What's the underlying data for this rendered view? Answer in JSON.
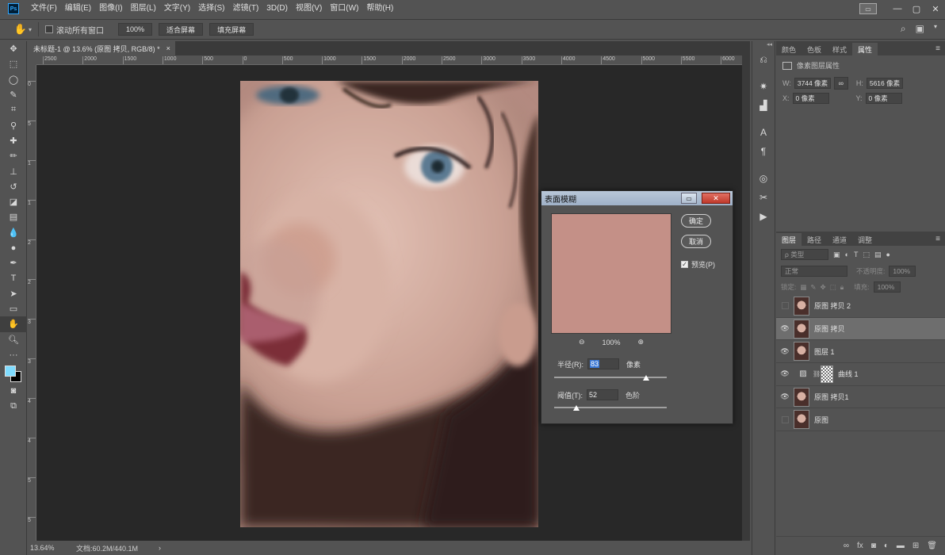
{
  "app": {
    "logo": "Ps",
    "menu": [
      "文件(F)",
      "编辑(E)",
      "图像(I)",
      "图层(L)",
      "文字(Y)",
      "选择(S)",
      "滤镜(T)",
      "3D(D)",
      "视图(V)",
      "窗口(W)",
      "帮助(H)"
    ]
  },
  "options": {
    "scroll_all_label": "滚动所有窗口",
    "zoom_value": "100%",
    "fit_screen": "适合屏幕",
    "fill_screen": "填充屏幕"
  },
  "document": {
    "tab_title": "未标题-1 @ 13.6% (原图 拷贝, RGB/8) *",
    "tab_close": "×",
    "ruler_h": [
      "2500",
      "2000",
      "1500",
      "1000",
      "500",
      "0",
      "500",
      "1000",
      "1500",
      "2000",
      "2500",
      "3000",
      "3500",
      "4000",
      "4500",
      "5000",
      "5500",
      "6000"
    ],
    "ruler_v": [
      "0",
      "5",
      "1",
      "1",
      "2",
      "2",
      "3",
      "3",
      "4",
      "4",
      "5",
      "5",
      "5"
    ],
    "zoom_status": "13.64%",
    "doc_status": "文档:60.2M/440.1M",
    "status_arrow": "›"
  },
  "properties": {
    "tabs": [
      "颜色",
      "色板",
      "样式",
      "属性"
    ],
    "active_tab": "属性",
    "title": "像素图层属性",
    "w_label": "W:",
    "w_value": "3744 像素",
    "h_label": "H:",
    "h_value": "5616 像素",
    "x_label": "X:",
    "x_value": "0 像素",
    "y_label": "Y:",
    "y_value": "0 像素",
    "link_icon": "∞"
  },
  "layers_panel": {
    "tabs": [
      "图层",
      "路径",
      "通道",
      "调整"
    ],
    "active_tab": "图层",
    "filter_placeholder": "ρ 类型",
    "blend_mode": "正常",
    "opacity_label": "不透明度:",
    "opacity_value": "100%",
    "lock_label": "锁定:",
    "fill_label": "填充:",
    "fill_value": "100%",
    "layers": [
      {
        "name": "原图 拷贝 2",
        "visible": false,
        "selected": false,
        "type": "pixel"
      },
      {
        "name": "原图 拷贝",
        "visible": true,
        "selected": true,
        "type": "pixel"
      },
      {
        "name": "图层 1",
        "visible": true,
        "selected": false,
        "type": "pixel"
      },
      {
        "name": "曲线 1",
        "visible": true,
        "selected": false,
        "type": "adjustment"
      },
      {
        "name": "原图 拷贝1",
        "visible": true,
        "selected": false,
        "type": "pixel"
      },
      {
        "name": "原图",
        "visible": false,
        "selected": false,
        "type": "pixel"
      }
    ]
  },
  "dialog": {
    "title": "表面模糊",
    "ok": "确定",
    "cancel": "取消",
    "preview_label": "预览(P)",
    "preview_checked": true,
    "zoom": "100%",
    "radius_label": "半径(R):",
    "radius_value": "83",
    "radius_unit": "像素",
    "radius_slider": 0.82,
    "threshold_label": "阈值(T):",
    "threshold_value": "52",
    "threshold_unit": "色阶",
    "threshold_slider": 0.2,
    "preview_color": "#c49087"
  }
}
